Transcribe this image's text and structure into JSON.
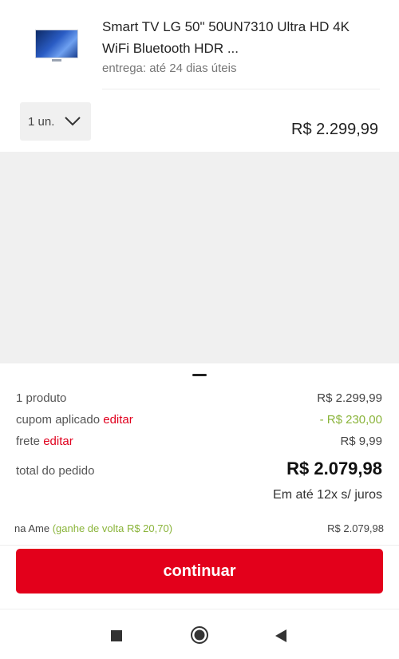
{
  "product": {
    "title": "Smart TV LG 50\" 50UN7310 Ultra HD 4K WiFi Bluetooth HDR ...",
    "delivery": "entrega: até 24 dias úteis",
    "quantity": "1 un.",
    "price": "R$ 2.299,99"
  },
  "summary": {
    "items_label": "1 produto",
    "items_value": "R$ 2.299,99",
    "coupon_label": "cupom aplicado",
    "coupon_edit": "editar",
    "coupon_value": "- R$ 230,00",
    "shipping_label": "frete",
    "shipping_edit": "editar",
    "shipping_value": "R$ 9,99",
    "total_label": "total do pedido",
    "total_value": "R$ 2.079,98",
    "installments": "Em até 12x s/ juros"
  },
  "ame": {
    "label": "na Ame",
    "cashback": "(ganhe de volta R$ 20,70)",
    "value": "R$ 2.079,98"
  },
  "actions": {
    "continue_label": "continuar"
  },
  "colors": {
    "accent": "#e3001b",
    "discount": "#8ab43a"
  },
  "icons": [
    "tv-thumbnail",
    "chevron-down-icon",
    "nav-recent-icon",
    "nav-home-icon",
    "nav-back-icon"
  ]
}
